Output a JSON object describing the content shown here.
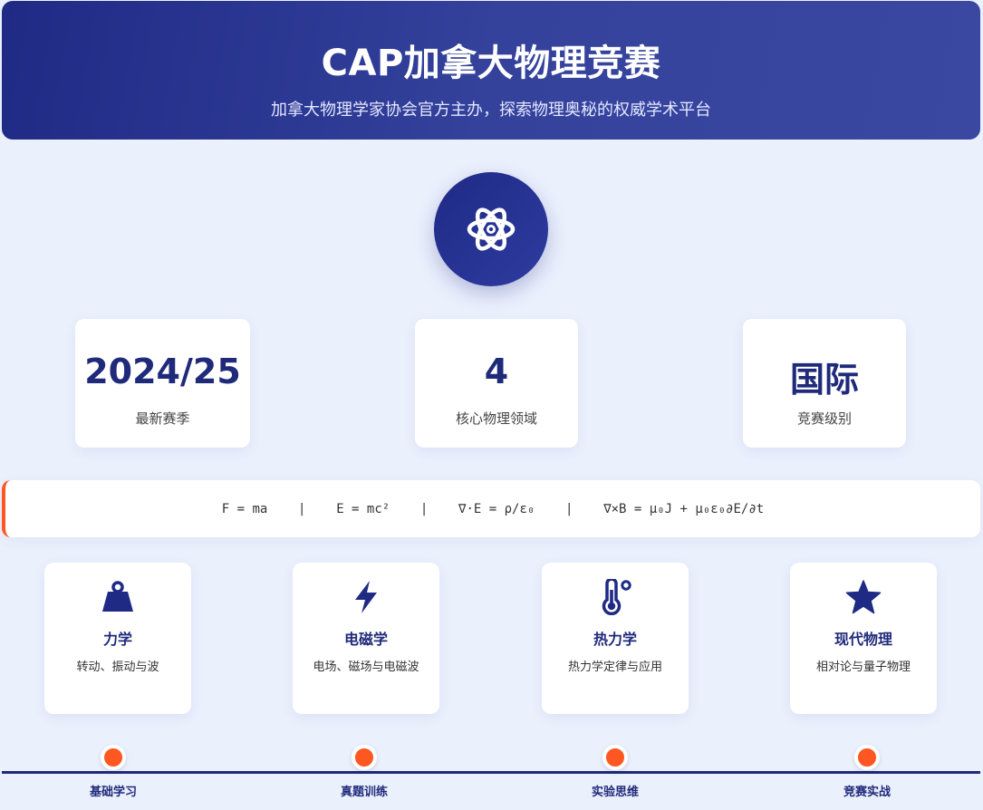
{
  "header": {
    "title": "CAP加拿大物理竞赛",
    "subtitle": "加拿大物理学家协会官方主办，探索物理奥秘的权威学术平台"
  },
  "logo": {
    "icon": "atom-icon"
  },
  "stats": [
    {
      "value": "2024/25",
      "label": "最新赛季"
    },
    {
      "value": "4",
      "label": "核心物理领域"
    },
    {
      "value": "国际",
      "label": "竞赛级别"
    }
  ],
  "formulas": "F = ma    |    E = mc²    |    ∇·E = ρ/ε₀    |    ∇×B = μ₀J + μ₀ε₀∂E/∂t",
  "cards": [
    {
      "icon": "weight-icon",
      "title": "力学",
      "desc": "转动、振动与波"
    },
    {
      "icon": "lightning-icon",
      "title": "电磁学",
      "desc": "电场、磁场与电磁波"
    },
    {
      "icon": "thermometer-icon",
      "title": "热力学",
      "desc": "热力学定律与应用"
    },
    {
      "icon": "star-icon",
      "title": "现代物理",
      "desc": "相对论与量子物理"
    }
  ],
  "timeline": [
    {
      "label": "基础学习"
    },
    {
      "label": "真题训练"
    },
    {
      "label": "实验思维"
    },
    {
      "label": "竞赛实战"
    }
  ],
  "colors": {
    "primary": "#1f2a7a",
    "accent": "#ff5722",
    "background": "#ebf0fd"
  }
}
